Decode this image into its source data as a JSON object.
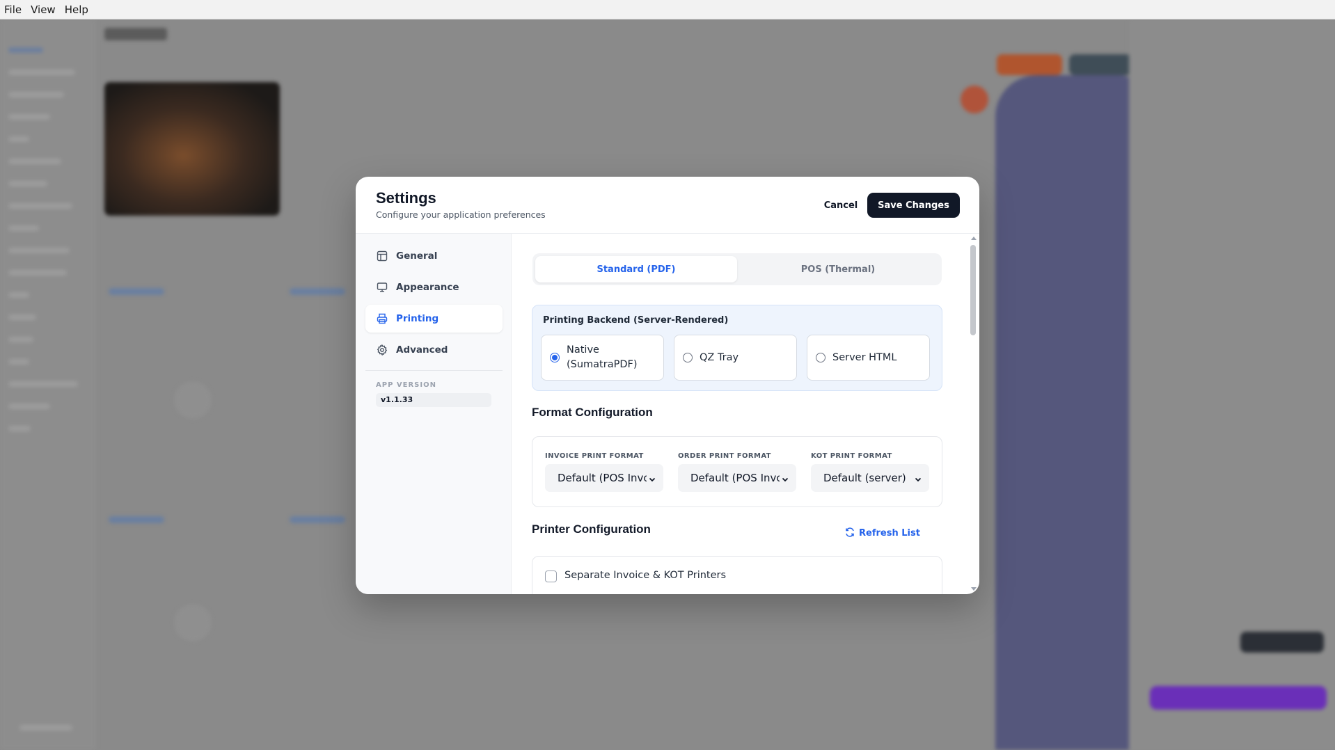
{
  "menu": [
    "File",
    "View",
    "Help"
  ],
  "modal": {
    "title": "Settings",
    "subtitle": "Configure your application preferences",
    "cancel_label": "Cancel",
    "save_label": "Save Changes"
  },
  "nav": {
    "items": [
      {
        "label": "General",
        "icon": "layout-icon",
        "active": false
      },
      {
        "label": "Appearance",
        "icon": "monitor-icon",
        "active": false
      },
      {
        "label": "Printing",
        "icon": "printer-icon",
        "active": true
      },
      {
        "label": "Advanced",
        "icon": "gear-icon",
        "active": false
      }
    ],
    "version_label": "APP VERSION",
    "version_value": "v1.1.33"
  },
  "printing": {
    "tabs": [
      {
        "label": "Standard (PDF)",
        "active": true
      },
      {
        "label": "POS (Thermal)",
        "active": false
      }
    ],
    "backend": {
      "title": "Printing Backend (Server-Rendered)",
      "options": [
        {
          "label": "Native (SumatraPDF)",
          "selected": true
        },
        {
          "label": "QZ Tray",
          "selected": false
        },
        {
          "label": "Server HTML",
          "selected": false
        }
      ]
    },
    "format_section": {
      "title": "Format Configuration",
      "fields": [
        {
          "label": "INVOICE PRINT FORMAT",
          "value": "Default (POS Invo"
        },
        {
          "label": "ORDER PRINT FORMAT",
          "value": "Default (POS Invo"
        },
        {
          "label": "KOT PRINT FORMAT",
          "value": "Default (server)"
        }
      ]
    },
    "printer_section": {
      "title": "Printer Configuration",
      "refresh_label": "Refresh List",
      "separate_printers_label": "Separate Invoice & KOT Printers",
      "separate_printers_checked": false
    }
  },
  "colors": {
    "accent": "#2563eb",
    "primary_button": "#111827"
  }
}
